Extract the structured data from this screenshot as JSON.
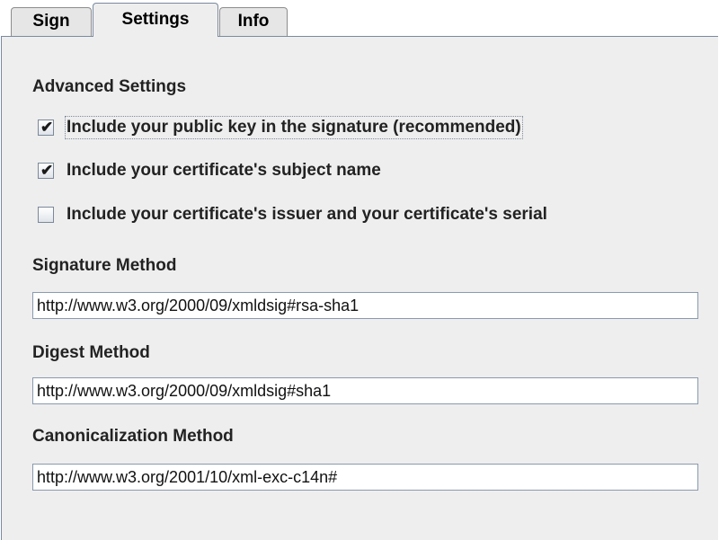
{
  "tabs": [
    {
      "label": "Sign",
      "active": false
    },
    {
      "label": "Settings",
      "active": true
    },
    {
      "label": "Info",
      "active": false
    }
  ],
  "advanced": {
    "title": "Advanced Settings",
    "checkboxes": [
      {
        "label": "Include your public key in the signature (recommended)",
        "checked": true
      },
      {
        "label": "Include your certificate's subject name",
        "checked": true
      },
      {
        "label": "Include your certificate's issuer and your certificate's serial",
        "checked": false
      }
    ]
  },
  "fields": {
    "signature_method": {
      "label": "Signature Method",
      "value": "http://www.w3.org/2000/09/xmldsig#rsa-sha1"
    },
    "digest_method": {
      "label": "Digest Method",
      "value": "http://www.w3.org/2000/09/xmldsig#sha1"
    },
    "canonicalization_method": {
      "label": "Canonicalization Method",
      "value": "http://www.w3.org/2001/10/xml-exc-c14n#"
    }
  },
  "colors": {
    "panel_bg": "#eeeeee",
    "tab_border": "#7a8aa0",
    "field_border": "#8a9aae"
  }
}
